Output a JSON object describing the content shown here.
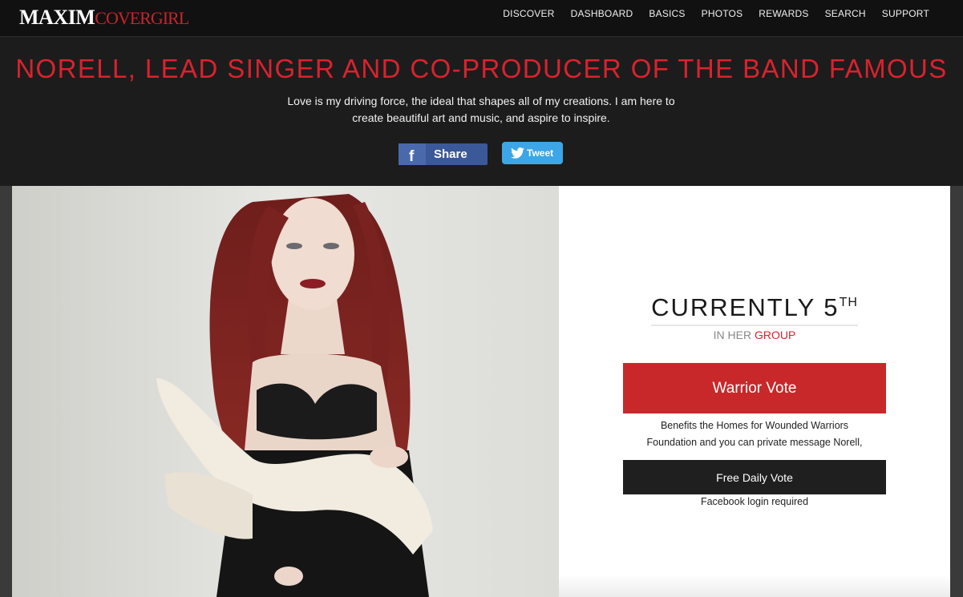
{
  "logo": {
    "maxim": "MAXIM",
    "covergirl": "COVERGIRL"
  },
  "nav": {
    "items": [
      "DISCOVER",
      "DASHBOARD",
      "BASICS",
      "PHOTOS",
      "REWARDS",
      "SEARCH",
      "SUPPORT"
    ]
  },
  "hero": {
    "headline": "NORELL, LEAD SINGER AND CO-PRODUCER OF THE BAND FAMOUS",
    "tagline": "Love is my driving force, the ideal that shapes all of my creations. I am here to create beautiful art and music, and aspire to inspire.",
    "share_label": "Share",
    "tweet_label": "Tweet"
  },
  "vote": {
    "rank_prefix": "CURRENTLY 5",
    "rank_suffix": "TH",
    "group_prefix": "IN HER ",
    "group_link": "GROUP",
    "warrior_label": "Warrior Vote",
    "benefits": "Benefits the Homes for Wounded Warriors Foundation and you can private message Norell,",
    "free_label": "Free Daily Vote",
    "facebook_note": "Facebook login required"
  },
  "colors": {
    "accent_red": "#d8232e",
    "warrior_red": "#c8282a",
    "facebook_blue": "#3b5998",
    "twitter_blue": "#3da6e6",
    "dark_bg": "#1c1c1c"
  },
  "icons": {
    "share": "facebook-f-icon",
    "tweet": "twitter-bird-icon"
  }
}
